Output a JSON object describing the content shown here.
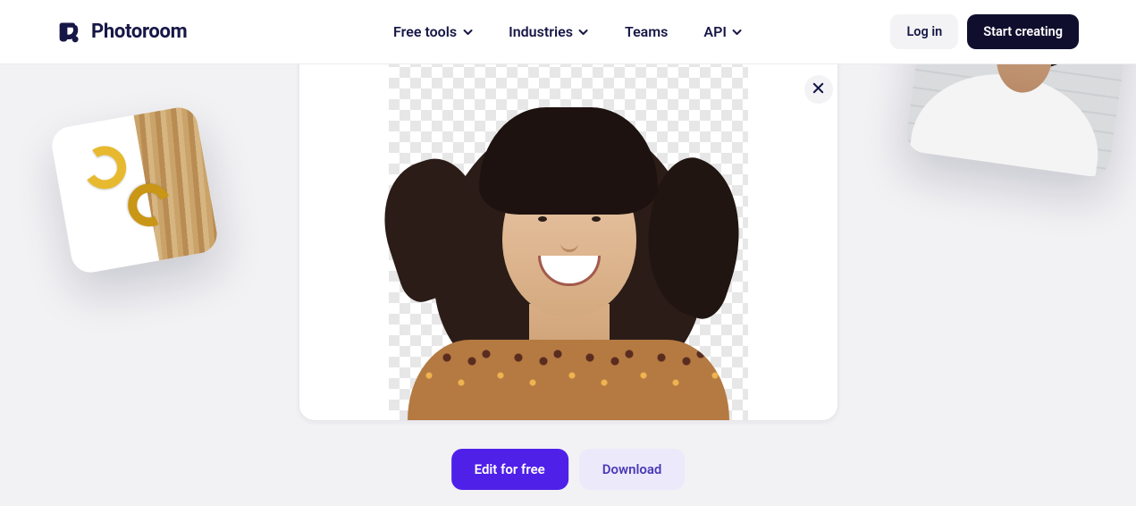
{
  "brand": {
    "name": "Photoroom"
  },
  "nav": {
    "free_tools": "Free tools",
    "industries": "Industries",
    "teams": "Teams",
    "api": "API"
  },
  "header_actions": {
    "login": "Log in",
    "start_creating": "Start creating"
  },
  "editor": {
    "close_label": "Close",
    "edit_button": "Edit for free",
    "download_button": "Download"
  },
  "decor": {
    "left_thumb": "product-earrings-thumbnail",
    "right_thumb": "portrait-thumbnail"
  }
}
